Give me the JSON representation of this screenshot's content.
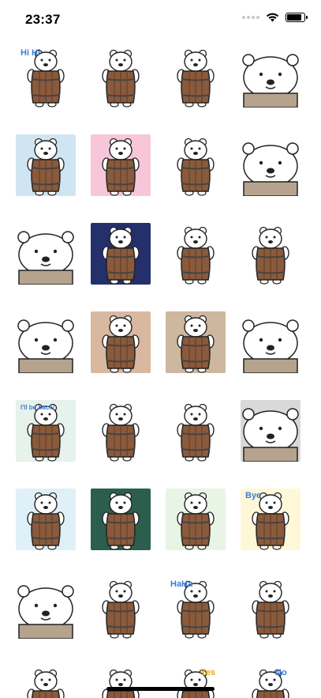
{
  "status_bar": {
    "time": "23:37",
    "battery_level": 0.85
  },
  "stickers": [
    {
      "name": "sticker-hi-wave",
      "caption": "Hi Hi",
      "bg": "#ffffff"
    },
    {
      "name": "sticker-dizzy",
      "caption": "",
      "bg": "#ffffff"
    },
    {
      "name": "sticker-annoyed",
      "caption": "",
      "bg": "#ffffff"
    },
    {
      "name": "sticker-crying",
      "caption": "",
      "bg": "#ffffff"
    },
    {
      "name": "sticker-sad-blue",
      "caption": "",
      "bg": "#cfe6f2"
    },
    {
      "name": "sticker-love-pink",
      "caption": "",
      "bg": "#f7c6d8"
    },
    {
      "name": "sticker-hearts",
      "caption": "",
      "bg": "#ffffff"
    },
    {
      "name": "sticker-speech-dots",
      "caption": "",
      "bg": "#ffffff"
    },
    {
      "name": "sticker-gloomy",
      "caption": "",
      "bg": "#ffffff"
    },
    {
      "name": "sticker-night-sky",
      "caption": "",
      "bg": "#24306b"
    },
    {
      "name": "sticker-shrug",
      "caption": "",
      "bg": "#ffffff"
    },
    {
      "name": "sticker-sweat",
      "caption": "",
      "bg": "#ffffff"
    },
    {
      "name": "sticker-tongue",
      "caption": "",
      "bg": "#ffffff"
    },
    {
      "name": "sticker-brown-bg",
      "caption": "",
      "bg": "#d9b8a0"
    },
    {
      "name": "sticker-mountain",
      "caption": "",
      "bg": "#cdb79e"
    },
    {
      "name": "sticker-sleepy",
      "caption": "",
      "bg": "#ffffff"
    },
    {
      "name": "sticker-ill-be-back",
      "caption": "I'll be back!",
      "bg": "#e6f2ec"
    },
    {
      "name": "sticker-singing",
      "caption": "",
      "bg": "#ffffff"
    },
    {
      "name": "sticker-fire",
      "caption": "",
      "bg": "#ffffff"
    },
    {
      "name": "sticker-grey-cloud",
      "caption": "",
      "bg": "#d9d9d9"
    },
    {
      "name": "sticker-frozen",
      "caption": "",
      "bg": "#dff0f8"
    },
    {
      "name": "sticker-forest",
      "caption": "",
      "bg": "#2c5e4d"
    },
    {
      "name": "sticker-plane",
      "caption": "",
      "bg": "#e8f5e4"
    },
    {
      "name": "sticker-bye",
      "caption": "Bye",
      "bg": "#fff8d8"
    },
    {
      "name": "sticker-peek-face",
      "caption": "",
      "bg": "#ffffff"
    },
    {
      "name": "sticker-rolling",
      "caption": "",
      "bg": "#ffffff"
    },
    {
      "name": "sticker-haha",
      "caption": "HaHa",
      "bg": "#ffffff"
    },
    {
      "name": "sticker-hug-barrel",
      "caption": "",
      "bg": "#ffffff"
    },
    {
      "name": "sticker-partial-1",
      "caption": "",
      "bg": "#ffffff"
    },
    {
      "name": "sticker-partial-2",
      "caption": "",
      "bg": "#ffffff"
    },
    {
      "name": "sticker-partial-yes",
      "caption": "Yes",
      "bg": "#ffffff"
    },
    {
      "name": "sticker-partial-no",
      "caption": "No",
      "bg": "#ffffff"
    }
  ],
  "colors": {
    "barrel": "#8a5a3c",
    "barrel_dark": "#5e3a24",
    "bear": "#ffffff",
    "outline": "#222222",
    "caption": "#3a7bd5"
  }
}
